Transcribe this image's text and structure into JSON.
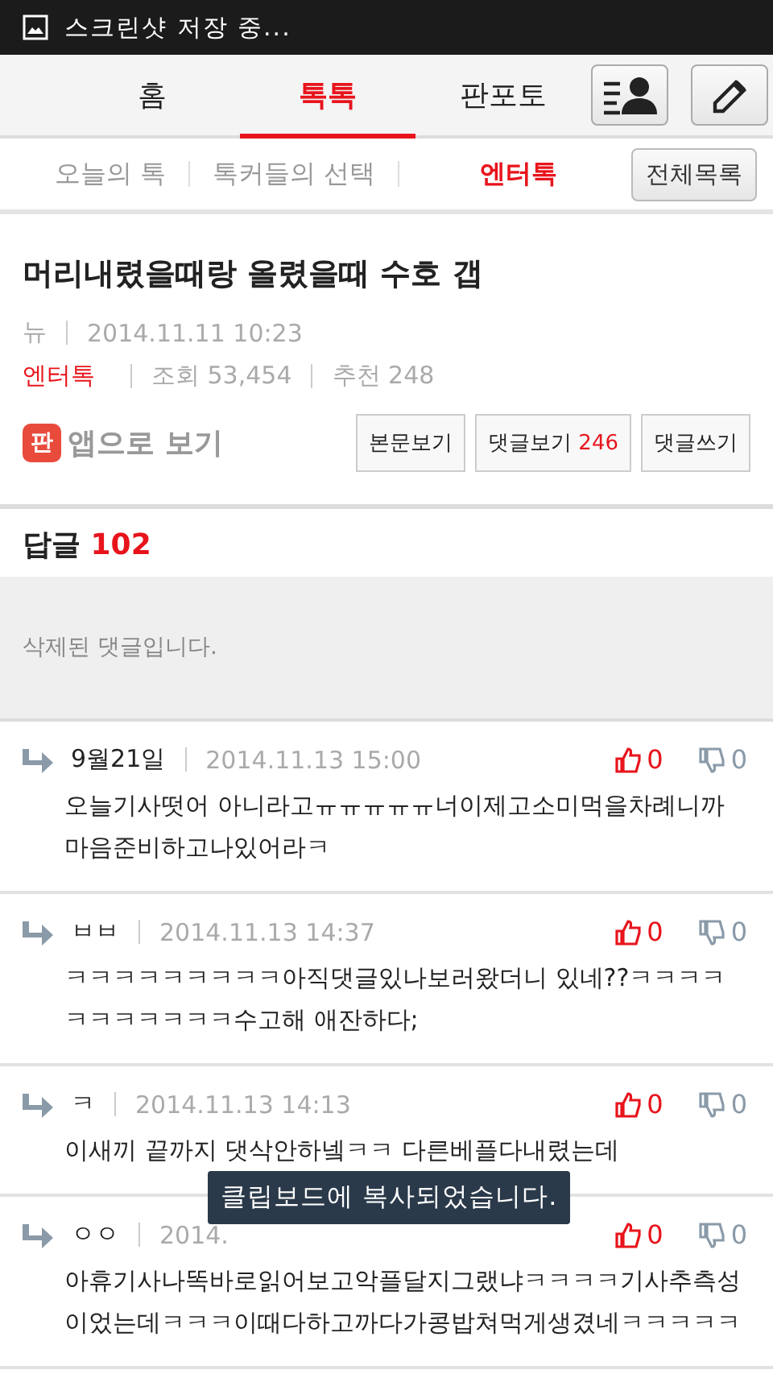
{
  "status_bar": {
    "notification": "스크린샷 저장 중..."
  },
  "main_tabs": [
    {
      "label": "홈",
      "selected": false
    },
    {
      "label": "톡톡",
      "selected": true
    },
    {
      "label": "판포토",
      "selected": false
    }
  ],
  "sub_tabs": [
    {
      "label": "오늘의 톡",
      "selected": false
    },
    {
      "label": "톡커들의 선택",
      "selected": false
    },
    {
      "label": "엔터톡",
      "selected": true
    }
  ],
  "all_list_button": "전체목록",
  "article": {
    "title": "머리내렸을때랑 올렸을때 수호 갭",
    "author": "뉴",
    "date": "2014.11.11 10:23",
    "category": "엔터톡",
    "views": "조회 53,454",
    "recommends": "추천 248",
    "app_view": {
      "badge": "판",
      "label": "앱으로 보기"
    },
    "buttons": [
      {
        "label": "본문보기"
      },
      {
        "label": "댓글보기",
        "count": "246"
      },
      {
        "label": "댓글쓰기"
      }
    ]
  },
  "replies": {
    "label": "답글",
    "count": "102",
    "deleted_notice": "삭제된 댓글입니다.",
    "comments": [
      {
        "author": "9월21일",
        "date": "2014.11.13 15:00",
        "likes": "0",
        "dislikes": "0",
        "text": "오늘기사떳어 아니라고ㅠㅠㅠㅠㅠ너이제고소미먹을차례니까 마음준비하고나있어라ㅋ"
      },
      {
        "author": "ㅂㅂ",
        "date": "2014.11.13 14:37",
        "likes": "0",
        "dislikes": "0",
        "text": "ㅋㅋㅋㅋㅋㅋㅋㅋㅋ아직댓글있나보러왔더니 있네??ㅋㅋㅋㅋㅋㅋㅋㅋㅋㅋㅋ수고해 애잔하다;"
      },
      {
        "author": "ㅋ",
        "date": "2014.11.13 14:13",
        "likes": "0",
        "dislikes": "0",
        "text": "이새끼 끝까지 댓삭안하넼ㅋㅋ 다른베플다내렸는데"
      },
      {
        "author": "ㅇㅇ",
        "date": "2014.",
        "likes": "0",
        "dislikes": "0",
        "text": "아휴기사나똑바로읽어보고악플달지그랬냐ㅋㅋㅋㅋ기사추측성이었는데ㅋㅋㅋ이때다하고까다가콩밥쳐먹게생겼네ㅋㅋㅋㅋㅋ"
      }
    ]
  },
  "toast": "클립보드에 복사되었습니다."
}
